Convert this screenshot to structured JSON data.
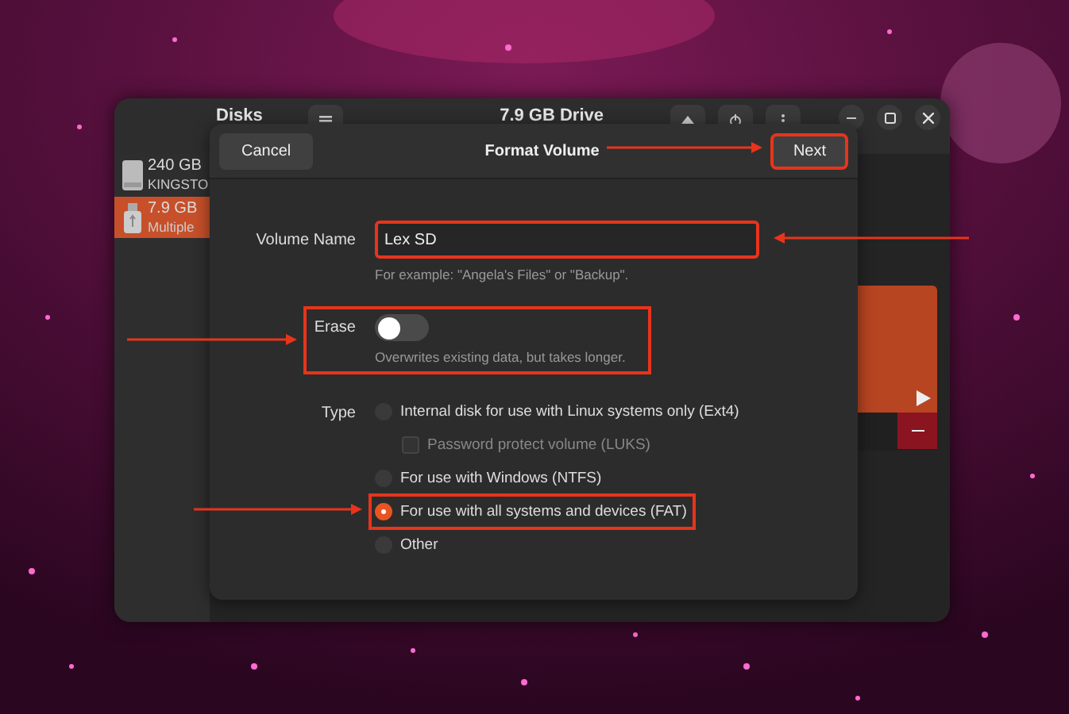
{
  "window": {
    "title": "Disks",
    "drive_title": "7.9 GB Drive"
  },
  "sidebar": {
    "items": [
      {
        "size": "240 GB",
        "name": "KINGSTO",
        "kind": "ssd",
        "selected": false
      },
      {
        "size": "7.9 GB",
        "name": "Multiple",
        "kind": "usb",
        "selected": true
      }
    ]
  },
  "dialog": {
    "title": "Format Volume",
    "cancel": "Cancel",
    "next": "Next",
    "volume_name": {
      "label": "Volume Name",
      "value": "Lex SD",
      "hint": "For example: \"Angela's Files\" or \"Backup\"."
    },
    "erase": {
      "label": "Erase",
      "on": false,
      "hint": "Overwrites existing data, but takes longer."
    },
    "type": {
      "label": "Type",
      "options": [
        {
          "label": "Internal disk for use with Linux systems only (Ext4)",
          "selected": false,
          "children": [
            {
              "label": "Password protect volume (LUKS)",
              "checked": false,
              "disabled": true
            }
          ]
        },
        {
          "label": "For use with Windows (NTFS)",
          "selected": false
        },
        {
          "label": "For use with all systems and devices (FAT)",
          "selected": true
        },
        {
          "label": "Other",
          "selected": false
        }
      ]
    }
  }
}
